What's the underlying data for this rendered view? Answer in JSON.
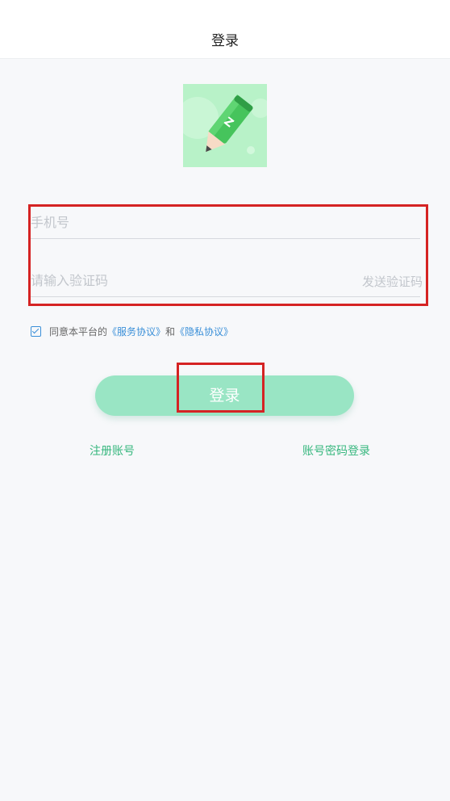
{
  "header": {
    "title": "登录"
  },
  "logo": {
    "icon": "pencil-logo-icon",
    "letter": "Z"
  },
  "form": {
    "phone_placeholder": "手机号",
    "code_placeholder": "请输入验证码",
    "send_code_label": "发送验证码"
  },
  "agreement": {
    "checked": true,
    "prefix": "同意本平台的",
    "service_link": "《服务协议》",
    "and": "和",
    "privacy_link": "《隐私协议》"
  },
  "login_button": {
    "label": "登录"
  },
  "links": {
    "register": "注册账号",
    "password_login": "账号密码登录"
  },
  "colors": {
    "accent_green": "#37b77e",
    "button_green": "#99e5c4",
    "link_blue": "#3a8fd8",
    "highlight_red": "#d52323"
  }
}
